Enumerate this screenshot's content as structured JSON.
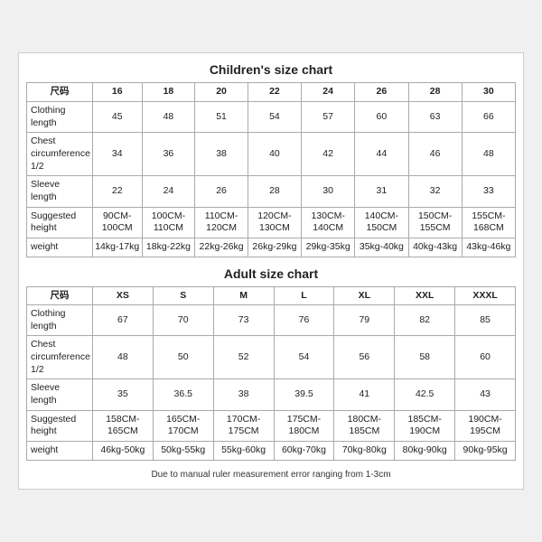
{
  "children_chart": {
    "title": "Children's size chart",
    "columns": [
      "尺码",
      "16",
      "18",
      "20",
      "22",
      "24",
      "26",
      "28",
      "30"
    ],
    "rows": [
      {
        "label": "Clothing\nlength",
        "values": [
          "45",
          "48",
          "51",
          "54",
          "57",
          "60",
          "63",
          "66"
        ]
      },
      {
        "label": "Chest\ncircumference\n1/2",
        "values": [
          "34",
          "36",
          "38",
          "40",
          "42",
          "44",
          "46",
          "48"
        ]
      },
      {
        "label": "Sleeve\nlength",
        "values": [
          "22",
          "24",
          "26",
          "28",
          "30",
          "31",
          "32",
          "33"
        ]
      },
      {
        "label": "Suggested\nheight",
        "values": [
          "90CM-100CM",
          "100CM-110CM",
          "110CM-120CM",
          "120CM-130CM",
          "130CM-140CM",
          "140CM-150CM",
          "150CM-155CM",
          "155CM-168CM"
        ]
      },
      {
        "label": "weight",
        "values": [
          "14kg-17kg",
          "18kg-22kg",
          "22kg-26kg",
          "26kg-29kg",
          "29kg-35kg",
          "35kg-40kg",
          "40kg-43kg",
          "43kg-46kg"
        ]
      }
    ]
  },
  "adult_chart": {
    "title": "Adult size chart",
    "columns": [
      "尺码",
      "XS",
      "S",
      "M",
      "L",
      "XL",
      "XXL",
      "XXXL"
    ],
    "rows": [
      {
        "label": "Clothing\nlength",
        "values": [
          "67",
          "70",
          "73",
          "76",
          "79",
          "82",
          "85"
        ]
      },
      {
        "label": "Chest\ncircumference\n1/2",
        "values": [
          "48",
          "50",
          "52",
          "54",
          "56",
          "58",
          "60"
        ]
      },
      {
        "label": "Sleeve\nlength",
        "values": [
          "35",
          "36.5",
          "38",
          "39.5",
          "41",
          "42.5",
          "43"
        ]
      },
      {
        "label": "Suggested\nheight",
        "values": [
          "158CM-165CM",
          "165CM-170CM",
          "170CM-175CM",
          "175CM-180CM",
          "180CM-185CM",
          "185CM-190CM",
          "190CM-195CM"
        ]
      },
      {
        "label": "weight",
        "values": [
          "46kg-50kg",
          "50kg-55kg",
          "55kg-60kg",
          "60kg-70kg",
          "70kg-80kg",
          "80kg-90kg",
          "90kg-95kg"
        ]
      }
    ]
  },
  "footer": "Due to manual ruler measurement error ranging from 1-3cm"
}
